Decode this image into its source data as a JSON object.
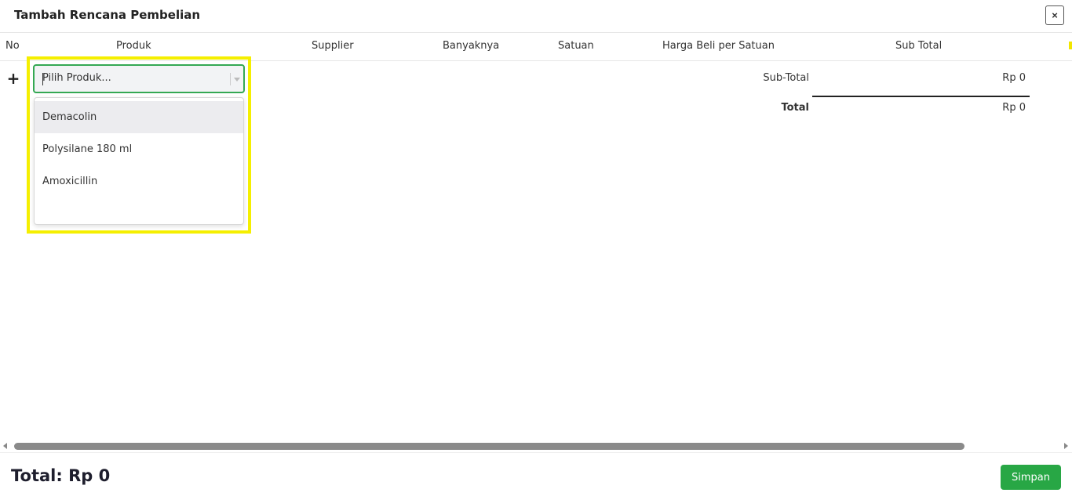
{
  "modal": {
    "title": "Tambah Rencana Pembelian",
    "close_label": "×"
  },
  "table": {
    "headers": {
      "no": "No",
      "produk": "Produk",
      "supplier": "Supplier",
      "banyaknya": "Banyaknya",
      "satuan": "Satuan",
      "harga": "Harga Beli per Satuan",
      "subtotal": "Sub Total"
    },
    "add_row_label": "+"
  },
  "product_select": {
    "placeholder": "Pilih Produk...",
    "options": [
      "Demacolin",
      "Polysilane 180 ml",
      "Amoxicillin"
    ],
    "highlighted_option": "Demacolin"
  },
  "summary": {
    "subtotal_label": "Sub-Total",
    "subtotal_value": "Rp 0",
    "total_label": "Total",
    "total_value": "Rp 0"
  },
  "footer": {
    "total_text": "Total: Rp 0",
    "save_label": "Simpan"
  },
  "colors": {
    "accent_green": "#28a745",
    "select_border": "#34a853",
    "highlight_yellow": "#f5ef00"
  }
}
